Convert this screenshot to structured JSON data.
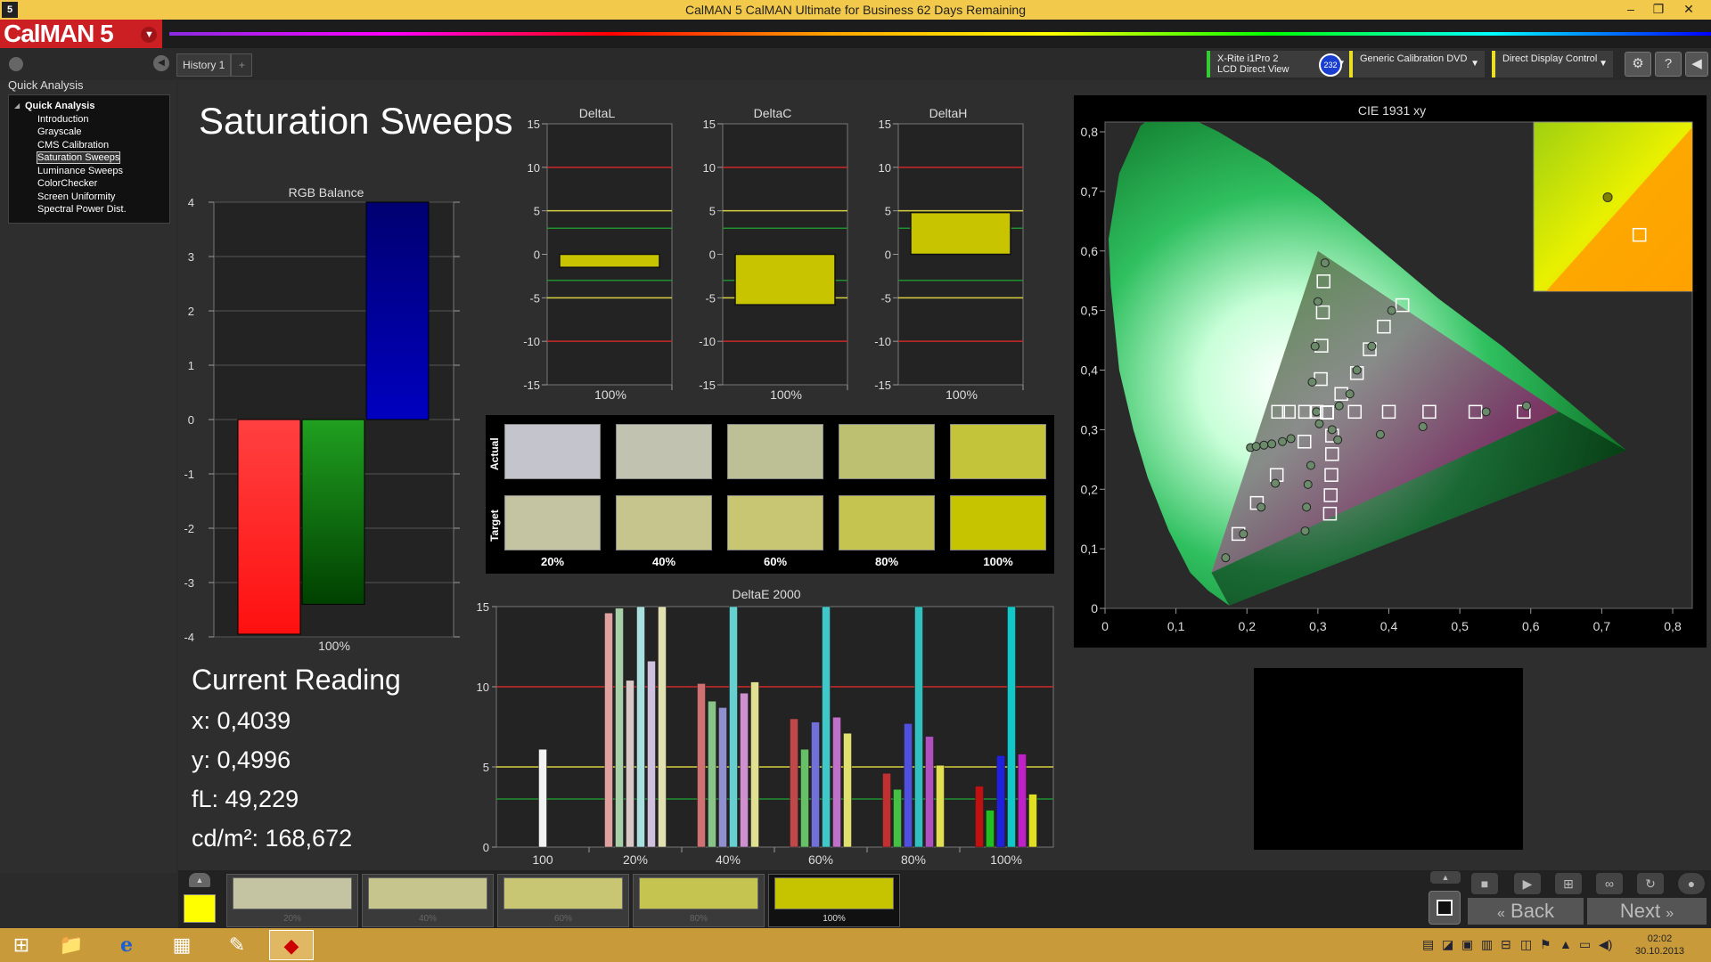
{
  "app": {
    "title": "CalMAN 5 CalMAN Ultimate for Business 62 Days Remaining",
    "logo": "CalMAN 5",
    "icon": "5",
    "window_controls": [
      "–",
      "❐",
      "✕"
    ]
  },
  "tabs": {
    "history": "History 1",
    "add": "+"
  },
  "devices": [
    {
      "line1": "X-Rite i1Pro 2",
      "line2": "LCD Direct View",
      "color": "#33cc33"
    },
    {
      "line1": "Generic Calibration DVD",
      "line2": "",
      "color": "#e8e020"
    },
    {
      "line1": "Direct Display Control",
      "line2": "",
      "color": "#e8e020"
    }
  ],
  "badge": "232",
  "sidebar": {
    "title": "Quick Analysis",
    "root": "Quick Analysis",
    "items": [
      "Introduction",
      "Grayscale",
      "CMS Calibration",
      "Saturation Sweeps",
      "Luminance Sweeps",
      "ColorChecker",
      "Screen Uniformity",
      "Spectral Power Dist."
    ],
    "selected_index": 3
  },
  "page": {
    "title": "Saturation Sweeps"
  },
  "rgb_balance": {
    "title": "RGB Balance",
    "category": "100%",
    "ylim": [
      -4,
      4
    ],
    "yticks": [
      "4",
      "3",
      "2",
      "1",
      "0",
      "-1",
      "-2",
      "-3",
      "-4"
    ],
    "values": {
      "red": -3.95,
      "green": -3.4,
      "blue": 4.0
    }
  },
  "delta_charts": {
    "yticks": [
      "15",
      "10",
      "5",
      "0",
      "-5",
      "-10",
      "-15"
    ],
    "ylim": [
      -15,
      15
    ],
    "category": "100%",
    "items": [
      {
        "title": "DeltaL",
        "low": -1.5,
        "high": 0
      },
      {
        "title": "DeltaC",
        "low": -5.8,
        "high": 0
      },
      {
        "title": "DeltaH",
        "low": 0,
        "high": 4.8
      }
    ]
  },
  "swatch_panel": {
    "actual_label": "Actual",
    "target_label": "Target",
    "labels": [
      "20%",
      "40%",
      "60%",
      "80%",
      "100%"
    ],
    "actual": [
      "#c3c4cc",
      "#c2c2b0",
      "#bdbf94",
      "#bec071",
      "#c4c43a"
    ],
    "target": [
      "#c4c3a2",
      "#c7c58e",
      "#c8c673",
      "#c6c451",
      "#c6c301"
    ]
  },
  "deltae": {
    "title": "DeltaE 2000",
    "yticks": [
      "15",
      "10",
      "5",
      "0"
    ],
    "ylim": [
      0,
      15
    ],
    "categories": [
      "100",
      "20%",
      "40%",
      "60%",
      "80%",
      "100%"
    ],
    "groups": [
      {
        "values": [
          6.1
        ],
        "colors": [
          "#f2f2f2"
        ]
      },
      {
        "values": [
          14.6,
          14.9,
          10.4,
          15,
          11.6,
          15
        ],
        "colors": [
          "#e0a0a0",
          "#a8d0a8",
          "#d8c8c8",
          "#a8e0e0",
          "#d0c0e0",
          "#e0e0b0"
        ]
      },
      {
        "values": [
          10.2,
          9.1,
          8.7,
          15,
          9.6,
          10.3
        ],
        "colors": [
          "#d07070",
          "#88c488",
          "#9090d0",
          "#66d0d0",
          "#d090d0",
          "#e0e090"
        ]
      },
      {
        "values": [
          8,
          6.1,
          7.8,
          15,
          8.1,
          7.1
        ],
        "colors": [
          "#c04848",
          "#66c066",
          "#7070d8",
          "#40c8c8",
          "#c070c8",
          "#e0e070"
        ]
      },
      {
        "values": [
          4.6,
          3.6,
          7.7,
          15,
          6.9,
          5.1
        ],
        "colors": [
          "#c03030",
          "#44c044",
          "#5050e0",
          "#30c0c0",
          "#b050c0",
          "#e0e050"
        ]
      },
      {
        "values": [
          3.8,
          2.3,
          5.7,
          15,
          5.8,
          3.3
        ],
        "colors": [
          "#c01010",
          "#20c020",
          "#2020e0",
          "#10c8c8",
          "#c020c8",
          "#e0e020"
        ]
      }
    ]
  },
  "cie": {
    "title": "CIE 1931 xy",
    "xticks": [
      "0",
      "0,1",
      "0,2",
      "0,3",
      "0,4",
      "0,5",
      "0,6",
      "0,7",
      "0,8"
    ],
    "yticks": [
      "0",
      "0,1",
      "0,2",
      "0,3",
      "0,4",
      "0,5",
      "0,6",
      "0,7",
      "0,8"
    ],
    "gamut": [
      [
        0.64,
        0.33
      ],
      [
        0.3,
        0.6
      ],
      [
        0.15,
        0.06
      ]
    ],
    "white": [
      0.3127,
      0.329
    ],
    "targets": [
      [
        0.298,
        0.33
      ],
      [
        0.282,
        0.33
      ],
      [
        0.259,
        0.33
      ],
      [
        0.244,
        0.33
      ],
      [
        0.352,
        0.33
      ],
      [
        0.4,
        0.33
      ],
      [
        0.457,
        0.33
      ],
      [
        0.522,
        0.33
      ],
      [
        0.59,
        0.33
      ],
      [
        0.308,
        0.549
      ],
      [
        0.307,
        0.497
      ],
      [
        0.305,
        0.441
      ],
      [
        0.304,
        0.385
      ],
      [
        0.32,
        0.29
      ],
      [
        0.32,
        0.259
      ],
      [
        0.319,
        0.224
      ],
      [
        0.318,
        0.19
      ],
      [
        0.317,
        0.159
      ],
      [
        0.281,
        0.28
      ],
      [
        0.242,
        0.224
      ],
      [
        0.214,
        0.177
      ],
      [
        0.188,
        0.125
      ],
      [
        0.333,
        0.36
      ],
      [
        0.355,
        0.395
      ],
      [
        0.373,
        0.435
      ],
      [
        0.393,
        0.473
      ],
      [
        0.419,
        0.509
      ]
    ],
    "measured": [
      [
        0.31,
        0.58
      ],
      [
        0.3,
        0.515
      ],
      [
        0.296,
        0.44
      ],
      [
        0.292,
        0.38
      ],
      [
        0.298,
        0.33
      ],
      [
        0.302,
        0.31
      ],
      [
        0.205,
        0.27
      ],
      [
        0.213,
        0.272
      ],
      [
        0.224,
        0.274
      ],
      [
        0.235,
        0.276
      ],
      [
        0.25,
        0.28
      ],
      [
        0.262,
        0.285
      ],
      [
        0.328,
        0.283
      ],
      [
        0.388,
        0.292
      ],
      [
        0.448,
        0.305
      ],
      [
        0.537,
        0.33
      ],
      [
        0.594,
        0.34
      ],
      [
        0.29,
        0.24
      ],
      [
        0.286,
        0.208
      ],
      [
        0.284,
        0.17
      ],
      [
        0.282,
        0.13
      ],
      [
        0.24,
        0.21
      ],
      [
        0.22,
        0.17
      ],
      [
        0.195,
        0.125
      ],
      [
        0.17,
        0.085
      ],
      [
        0.32,
        0.3
      ],
      [
        0.33,
        0.34
      ],
      [
        0.345,
        0.36
      ],
      [
        0.355,
        0.4
      ],
      [
        0.376,
        0.44
      ],
      [
        0.404,
        0.5
      ]
    ],
    "inset_measured": [
      0.27,
      0.72
    ],
    "inset_target": [
      0.3,
      0.68
    ]
  },
  "reading": {
    "title": "Current Reading",
    "x": "x: 0,4039",
    "y": "y: 0,4996",
    "fl": "fL: 49,229",
    "cdm2": "cd/m²: 168,672"
  },
  "patches": [
    {
      "label": "20%",
      "color": "#c4c3a2"
    },
    {
      "label": "40%",
      "color": "#c7c58e"
    },
    {
      "label": "60%",
      "color": "#c8c673"
    },
    {
      "label": "80%",
      "color": "#c6c451"
    },
    {
      "label": "100%",
      "color": "#c6c301"
    }
  ],
  "nav": {
    "back": "Back",
    "next": "Next"
  },
  "clock": {
    "time": "02:02",
    "date": "30.10.2013"
  }
}
